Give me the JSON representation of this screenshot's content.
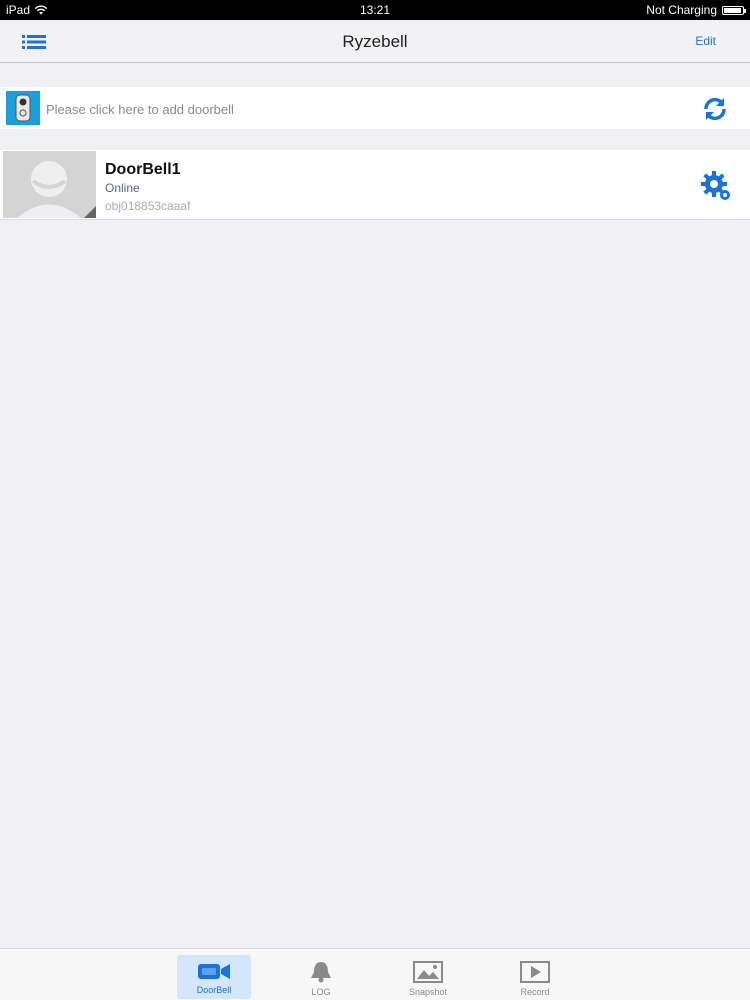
{
  "status_bar": {
    "device": "iPad",
    "time": "13:21",
    "charging": "Not Charging",
    "battery_level": 0.95
  },
  "header": {
    "title": "Ryzebell",
    "edit_label": "Edit",
    "menu_icon": "list-menu-icon"
  },
  "add_device": {
    "label": "Please click here to add doorbell",
    "thumb_icon": "doorbell-device-icon",
    "refresh_icon": "refresh-icon"
  },
  "devices": [
    {
      "name": "DoorBell1",
      "status": "Online",
      "uid": "obj018853caaaf",
      "avatar_icon": "person-placeholder-icon",
      "settings_icon": "gear-icon"
    }
  ],
  "tabs": [
    {
      "label": "DoorBell",
      "icon": "video-camera-icon",
      "active": true
    },
    {
      "label": "LOG",
      "icon": "bell-icon",
      "active": false
    },
    {
      "label": "Snapshot",
      "icon": "image-icon",
      "active": false
    },
    {
      "label": "Record",
      "icon": "play-icon",
      "active": false
    }
  ],
  "colors": {
    "accent": "#1a73d9",
    "background": "#efeff4",
    "status_online": "#4a6a8a"
  }
}
